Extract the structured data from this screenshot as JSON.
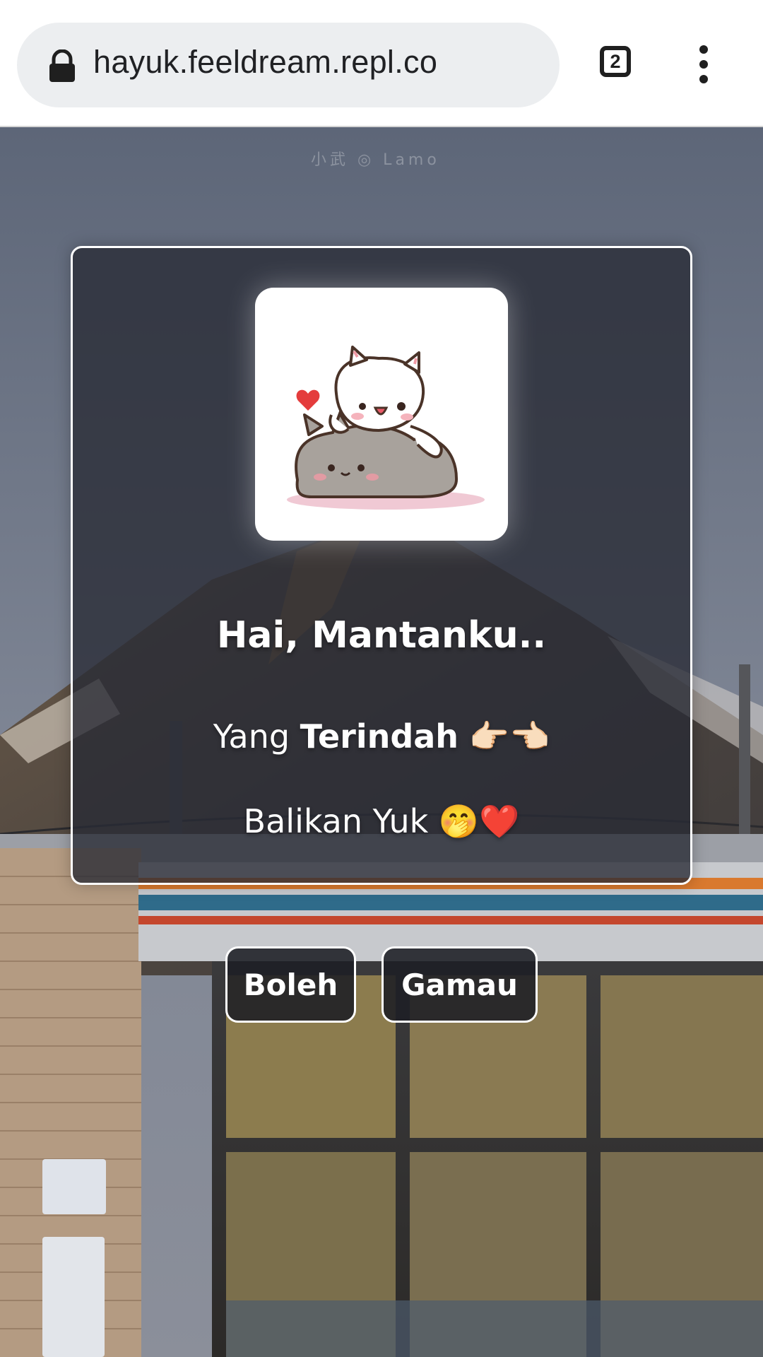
{
  "browser": {
    "url": "hayuk.feeldream.repl.co",
    "tab_count": "2",
    "lock_icon": "lock-icon",
    "menu_icon": "kebab-menu-icon"
  },
  "background": {
    "watermark": "小武 ◎ Lamo"
  },
  "card": {
    "image": "two-cats-hugging-sticker",
    "title": "Hai, Mantanku..",
    "line1_prefix": "Yang ",
    "line1_bold": "Terindah",
    "line1_emoji": " 👉🏻👈🏻",
    "line2": "Balikan Yuk 🤭❤️"
  },
  "buttons": {
    "yes_label": "Boleh",
    "no_label": "Gamau"
  },
  "colors": {
    "card_bg": "#2d2f3a",
    "card_border": "#ffffff",
    "text": "#ffffff"
  }
}
